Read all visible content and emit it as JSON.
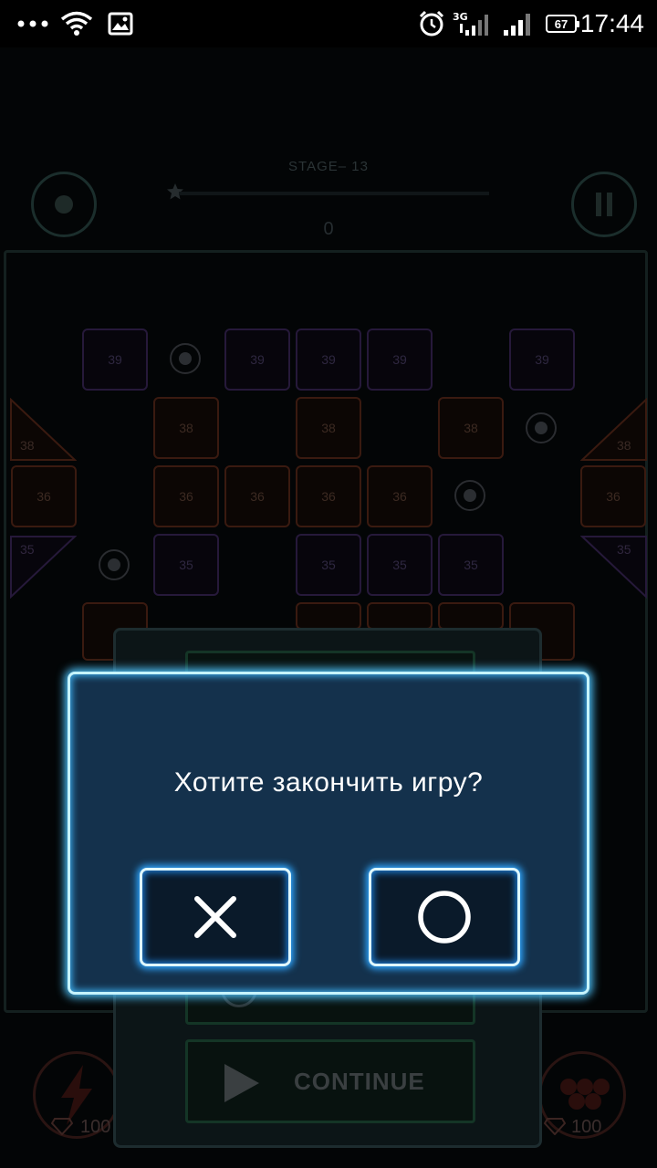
{
  "status_bar": {
    "time": "17:44",
    "battery": "67",
    "network": "3G",
    "icons": [
      "more-dots-icon",
      "wifi-icon",
      "image-notification-icon",
      "alarm-icon",
      "signal-3g-icon",
      "signal-icon",
      "battery-icon"
    ]
  },
  "game": {
    "stage_label": "STAGE– 13",
    "score": "0",
    "bricks": [
      {
        "v": "39",
        "c": "purple"
      },
      {
        "v": "39",
        "c": "purple"
      },
      {
        "v": "39",
        "c": "purple"
      },
      {
        "v": "39",
        "c": "purple"
      },
      {
        "v": "39",
        "c": "purple"
      },
      {
        "v": "38",
        "c": "orange"
      },
      {
        "v": "38",
        "c": "orange"
      },
      {
        "v": "38",
        "c": "orange"
      },
      {
        "v": "36",
        "c": "orange"
      },
      {
        "v": "36",
        "c": "orange"
      },
      {
        "v": "36",
        "c": "orange"
      },
      {
        "v": "36",
        "c": "orange"
      },
      {
        "v": "36",
        "c": "orange"
      },
      {
        "v": "36",
        "c": "orange"
      },
      {
        "v": "35",
        "c": "purple"
      },
      {
        "v": "35",
        "c": "purple"
      },
      {
        "v": "35",
        "c": "purple"
      },
      {
        "v": "35",
        "c": "purple"
      }
    ],
    "triangles": {
      "left_38": "38",
      "right_38": "38",
      "left_35": "35",
      "right_35": "35"
    },
    "gem_left": "100",
    "gem_right": "100"
  },
  "pause_menu": {
    "continue_label": "CONTINUE"
  },
  "dialog": {
    "message": "Хотите закончить игру?",
    "no_icon": "close-x-icon",
    "yes_icon": "circle-o-icon"
  },
  "colors": {
    "dialog_bg": "#14314c",
    "dialog_glow": "#4fc6ff",
    "button_border": "#dff8ff"
  }
}
